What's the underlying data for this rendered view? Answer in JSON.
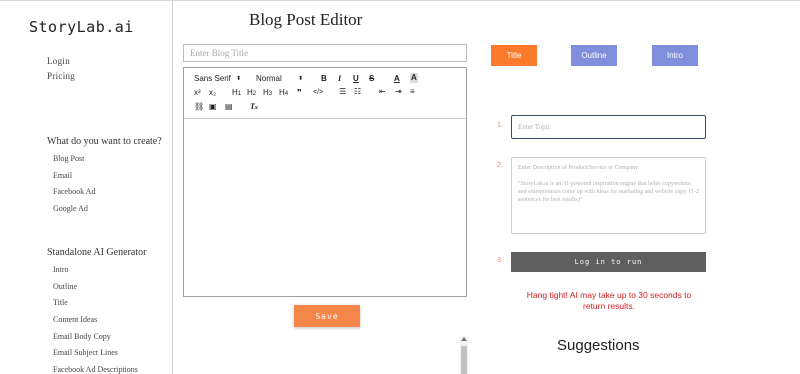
{
  "app": {
    "logo": "StoryLab.ai"
  },
  "sidebar": {
    "top_links": [
      "Login",
      "Pricing"
    ],
    "create_heading": "What do you want to create?",
    "create_items": [
      "Blog Post",
      "Email",
      "Facebook Ad",
      "Google Ad"
    ],
    "standalone_heading": "Standalone AI Generator",
    "standalone_items": [
      "Intro",
      "Outline",
      "Title",
      "Content Ideas",
      "Email Body Copy",
      "Email Subject Lines",
      "Facebook Ad Descriptions"
    ]
  },
  "editor": {
    "page_title": "Blog Post Editor",
    "title_placeholder": "Enter Blog Title",
    "font_select": "Sans Serif",
    "size_select": "Normal",
    "save_label": "Save"
  },
  "generator": {
    "tabs": [
      {
        "label": "Title",
        "color": "#fb7a2c"
      },
      {
        "label": "Outline",
        "color": "#7f8fdc"
      },
      {
        "label": "Intro",
        "color": "#7f8fdc"
      }
    ],
    "steps": [
      "1.",
      "2.",
      "3."
    ],
    "topic_placeholder": "Enter Topic",
    "desc_placeholder_1": "Enter Description of Product/Service or Company.",
    "desc_placeholder_2": "\"StoryLab.ai is an AI-powered inspiration engine that helps copywriters and entrepreneurs come up with ideas for marketing and website copy. (1-2 sentences for best results)\"",
    "run_label": "Log in to run",
    "wait_note": "Hang tight! AI may take up to 30 seconds to return results.",
    "suggestions_heading": "Suggestions"
  },
  "colors": {
    "accent": "#f5864a",
    "tab_inactive": "#7f8fdc",
    "warning": "#d11f1f"
  }
}
